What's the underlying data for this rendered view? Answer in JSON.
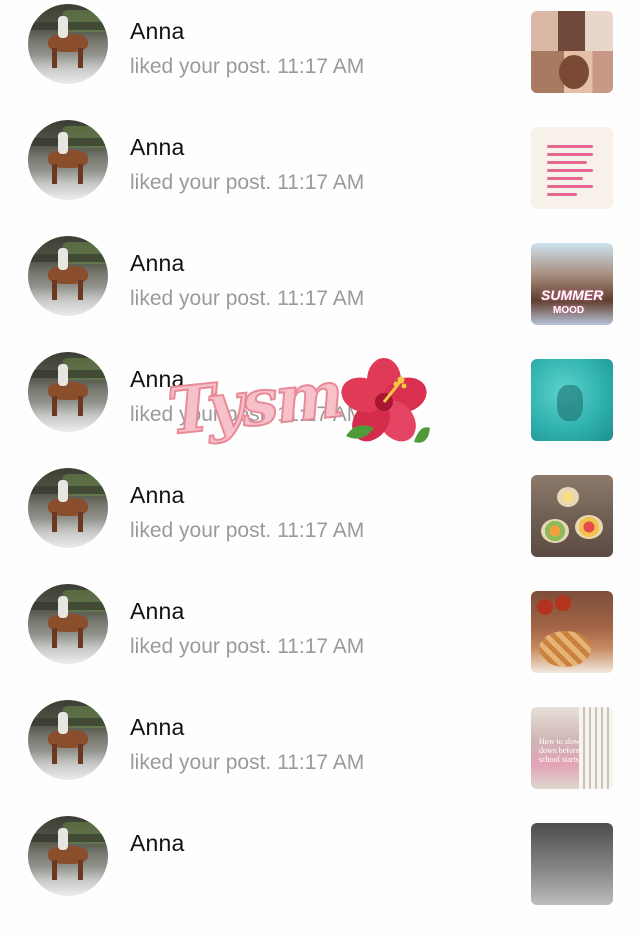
{
  "notifications": [
    {
      "name": "Anna",
      "text": "liked your post. 11:17 AM"
    },
    {
      "name": "Anna",
      "text": "liked your post. 11:17 AM"
    },
    {
      "name": "Anna",
      "text": "liked your post. 11:17 AM"
    },
    {
      "name": "Anna",
      "text": "liked your post. 11:17 AM"
    },
    {
      "name": "Anna",
      "text": "liked your post. 11:17 AM"
    },
    {
      "name": "Anna",
      "text": "liked your post. 11:17 AM"
    },
    {
      "name": "Anna",
      "text": "liked your post. 11:17 AM"
    },
    {
      "name": "Anna",
      "text": ""
    }
  ],
  "thumbnails": {
    "summer_line1": "SUMMER",
    "summer_line2": "MOOD",
    "pink_caption": "How to slow down before school starts"
  },
  "sticker": {
    "text": "Tysm",
    "emoji": "hibiscus-icon"
  },
  "colors": {
    "name": "#111111",
    "meta": "#9a9a9a",
    "sticker_fill": "#f7c1c9",
    "sticker_stroke": "#e88a98"
  }
}
